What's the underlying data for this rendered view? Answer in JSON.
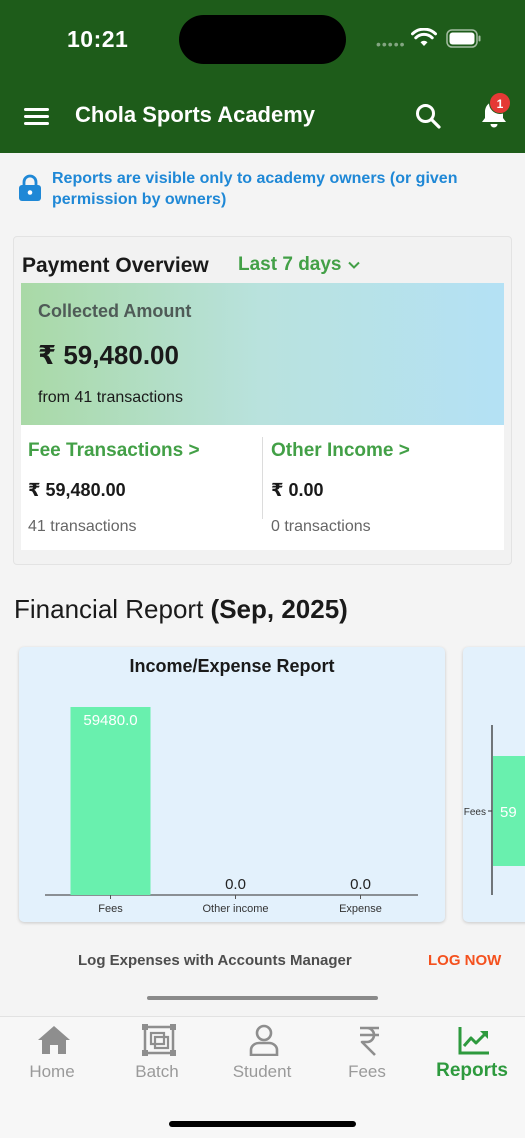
{
  "status_bar": {
    "time": "10:21"
  },
  "app_bar": {
    "title": "Chola Sports Academy",
    "notification_count": "1"
  },
  "notice": {
    "text": "Reports are visible only to academy owners (or given permission by owners)"
  },
  "payment_overview": {
    "title": "Payment Overview",
    "range": "Last 7 days",
    "collected_label": "Collected Amount",
    "collected_amount": "₹ 59,480.00",
    "collected_sub": "from 41 transactions",
    "fee": {
      "label": "Fee Transactions >",
      "amount": "₹ 59,480.00",
      "count": "41 transactions"
    },
    "other": {
      "label": "Other Income >",
      "amount": "₹ 0.00",
      "count": "0 transactions"
    }
  },
  "financial_report": {
    "prefix": "Financial Report ",
    "period": "(Sep, 2025)"
  },
  "chart_data": [
    {
      "type": "bar",
      "title": "Income/Expense Report",
      "categories": [
        "Fees",
        "Other income",
        "Expense"
      ],
      "values": [
        59480.0,
        0.0,
        0.0
      ],
      "data_labels": [
        "59480.0",
        "0.0",
        "0.0"
      ],
      "bar_color": "#69f0ae",
      "grid": false
    },
    {
      "type": "bar",
      "orientation": "horizontal",
      "categories": [
        "Fees"
      ],
      "visible_label_fragment": "59",
      "bar_color": "#69f0ae"
    }
  ],
  "log_expenses": {
    "text": "Log Expenses with Accounts Manager",
    "action": "LOG NOW"
  },
  "bottom_nav": {
    "items": [
      {
        "label": "Home",
        "icon": "home-icon"
      },
      {
        "label": "Batch",
        "icon": "batch-icon"
      },
      {
        "label": "Student",
        "icon": "student-icon"
      },
      {
        "label": "Fees",
        "icon": "rupee-icon"
      },
      {
        "label": "Reports",
        "icon": "reports-icon"
      }
    ],
    "active": "Reports"
  },
  "colors": {
    "primary": "#1e5c1a",
    "accent": "#43a047",
    "link": "#1f88d6",
    "action": "#f4511e"
  }
}
